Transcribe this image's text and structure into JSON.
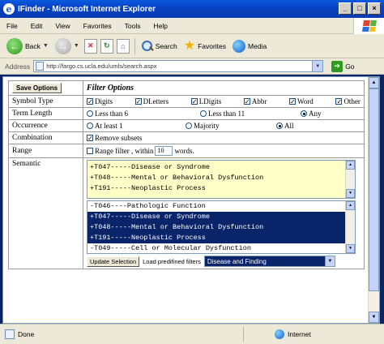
{
  "window": {
    "title": "IFinder - Microsoft Internet Explorer",
    "buttons": [
      "_",
      "□",
      "×"
    ]
  },
  "menu": [
    "File",
    "Edit",
    "View",
    "Favorites",
    "Tools",
    "Help"
  ],
  "toolbar": {
    "back": "Back",
    "search": "Search",
    "favorites": "Favorites",
    "media": "Media"
  },
  "address": {
    "label": "Address",
    "url": "http://fargo.cs.ucla.edu/umls/search.aspx",
    "go": "Go"
  },
  "form": {
    "save_options": "Save Options",
    "header": "Filter Options",
    "symbol_type": {
      "label": "Symbol Type",
      "options": [
        {
          "label": "Digits",
          "checked": true
        },
        {
          "label": "DLetters",
          "checked": true
        },
        {
          "label": "LDigits",
          "checked": true
        },
        {
          "label": "Abbr",
          "checked": true
        },
        {
          "label": "Word",
          "checked": true
        },
        {
          "label": "Other",
          "checked": true
        }
      ]
    },
    "term_length": {
      "label": "Term Length",
      "options": [
        {
          "label": "Less than 6",
          "selected": false
        },
        {
          "label": "Less than 11",
          "selected": false
        },
        {
          "label": "Any",
          "selected": true
        }
      ]
    },
    "occurrence": {
      "label": "Occurrence",
      "options": [
        {
          "label": "At least 1",
          "selected": false
        },
        {
          "label": "Majority",
          "selected": false
        },
        {
          "label": "All",
          "selected": true
        }
      ]
    },
    "combination": {
      "label": "Combination",
      "option": "Remove subsets",
      "checked": true
    },
    "range": {
      "label": "Range",
      "option": "Range filter , within",
      "checked": false,
      "value": "10",
      "suffix": "words."
    },
    "semantic": {
      "label": "Semantic",
      "selected_types": [
        "+T047-----Disease or Syndrome",
        "+T048-----Mental or Behavioral Dysfunction",
        "+T191-----Neoplastic Process"
      ],
      "list": [
        {
          "text": "-T046----Pathologic Function",
          "selected": false
        },
        {
          "text": "+T047-----Disease or Syndrome",
          "selected": true
        },
        {
          "text": "+T048-----Mental or Behavioral Dysfunction",
          "selected": true
        },
        {
          "text": "+T191-----Neoplastic Process",
          "selected": true
        },
        {
          "text": "-T049-----Cell or Molecular Dysfunction",
          "selected": false
        }
      ],
      "update_button": "Update Selection",
      "load_label": "Load predifined filters",
      "filter_value": "Disease and Finding"
    }
  },
  "status": {
    "text": "Done",
    "zone": "Internet"
  },
  "colors": {
    "titlebar": "#0a4fd0",
    "highlight": "#0a246a",
    "semantic_bg": "#ffffc8"
  }
}
